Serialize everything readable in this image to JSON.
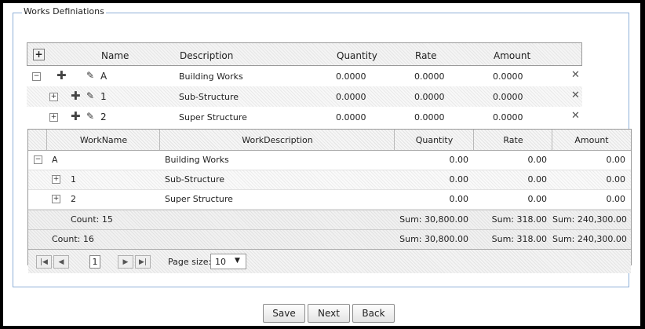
{
  "fieldset": {
    "legend": "Works Definiations"
  },
  "tree": {
    "headers": {
      "name": "Name",
      "description": "Description",
      "quantity": "Quantity",
      "rate": "Rate",
      "amount": "Amount"
    },
    "rows": [
      {
        "name": "A",
        "description": "Building Works",
        "quantity": "0.0000",
        "rate": "0.0000",
        "amount": "0.0000"
      },
      {
        "name": "1",
        "description": "Sub-Structure",
        "quantity": "0.0000",
        "rate": "0.0000",
        "amount": "0.0000"
      },
      {
        "name": "2",
        "description": "Super Structure",
        "quantity": "0.0000",
        "rate": "0.0000",
        "amount": "0.0000"
      }
    ]
  },
  "grid": {
    "headers": {
      "workname": "WorkName",
      "workdescription": "WorkDescription",
      "quantity": "Quantity",
      "rate": "Rate",
      "amount": "Amount"
    },
    "rows": [
      {
        "name": "A",
        "description": "Building Works",
        "quantity": "0.00",
        "rate": "0.00",
        "amount": "0.00"
      },
      {
        "name": "1",
        "description": "Sub-Structure",
        "quantity": "0.00",
        "rate": "0.00",
        "amount": "0.00"
      },
      {
        "name": "2",
        "description": "Super Structure",
        "quantity": "0.00",
        "rate": "0.00",
        "amount": "0.00"
      }
    ],
    "group_footer": {
      "count": "Count: 15",
      "sum_qty": "Sum: 30,800.00",
      "sum_rate": "Sum: 318.00",
      "sum_amount": "Sum: 240,300.00"
    },
    "footer": {
      "count": "Count: 16",
      "sum_qty": "Sum: 30,800.00",
      "sum_rate": "Sum: 318.00",
      "sum_amount": "Sum: 240,300.00"
    },
    "pager": {
      "page": "1",
      "page_size_label": "Page size:",
      "page_size": "10"
    }
  },
  "buttons": {
    "save": "Save",
    "next": "Next",
    "back": "Back"
  }
}
